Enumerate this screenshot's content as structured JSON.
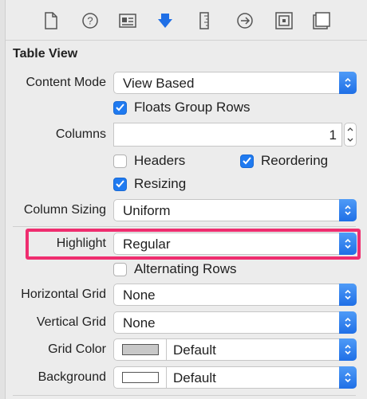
{
  "inspector_tabs": [
    {
      "name": "file-inspector",
      "active": false
    },
    {
      "name": "quick-help",
      "active": false
    },
    {
      "name": "identity-inspector",
      "active": false
    },
    {
      "name": "attributes-inspector",
      "active": true
    },
    {
      "name": "size-inspector",
      "active": false
    },
    {
      "name": "connections-inspector",
      "active": false
    },
    {
      "name": "bindings-inspector",
      "active": false
    },
    {
      "name": "view-effects-inspector",
      "active": false
    }
  ],
  "section_title": "Table View",
  "content_mode": {
    "label": "Content Mode",
    "value": "View Based"
  },
  "floats_group_rows": {
    "label": "Floats Group Rows",
    "checked": true
  },
  "columns": {
    "label": "Columns",
    "value": "1"
  },
  "headers": {
    "label": "Headers",
    "checked": false
  },
  "reordering": {
    "label": "Reordering",
    "checked": true
  },
  "resizing": {
    "label": "Resizing",
    "checked": true
  },
  "column_sizing": {
    "label": "Column Sizing",
    "value": "Uniform"
  },
  "highlight": {
    "label": "Highlight",
    "value": "Regular"
  },
  "alternating_rows": {
    "label": "Alternating Rows",
    "checked": false
  },
  "horizontal_grid": {
    "label": "Horizontal Grid",
    "value": "None"
  },
  "vertical_grid": {
    "label": "Vertical Grid",
    "value": "None"
  },
  "grid_color": {
    "label": "Grid Color",
    "value": "Default",
    "swatch": "#c8c8c8"
  },
  "background": {
    "label": "Background",
    "value": "Default",
    "swatch": "#ffffff"
  },
  "colors": {
    "accent": "#1f7af0",
    "annotation": "#ef2d6f",
    "active_tab": "#1f6fe6"
  }
}
